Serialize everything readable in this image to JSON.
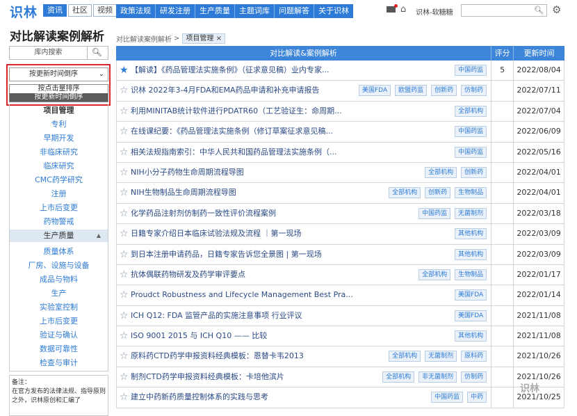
{
  "header": {
    "logo": "识林",
    "subtabs": [
      "资讯",
      "社区",
      "视频"
    ],
    "nav": [
      "政策法规",
      "研发注册",
      "生产质量",
      "主题词库",
      "问题解答",
      "关于识林"
    ],
    "user": "识林-软糖糖"
  },
  "sidebar": {
    "title": "对比解读案例解析",
    "search_placeholder": "库内搜索",
    "sort_value": "按更新时间倒序",
    "sort_options": [
      "按点击量排序",
      "按更新时间倒序"
    ],
    "items_top": [
      "项目管理",
      "专利",
      "早期开发",
      "非临床研究",
      "临床研究",
      "CMC药学研究",
      "注册",
      "上市后变更",
      "药物警戒"
    ],
    "group": "生产质量",
    "items_bottom": [
      "质量体系",
      "厂房、设施与设备",
      "成品与物料",
      "生产",
      "实验室控制",
      "上市后变更",
      "验证与确认",
      "数据可靠性",
      "检查与审计"
    ],
    "note": "备注：\n在官方发布的法律法规、指导原则之外，识林原创和汇编了"
  },
  "breadcrumb": {
    "root": "对比解读案例解析",
    "sep": ">",
    "tag": "项目管理 ×"
  },
  "table": {
    "headers": [
      "对比解读&案例解析",
      "评分",
      "更新时间"
    ],
    "rows": [
      {
        "title": "【解读】《药品管理法实施条例》（征求意见稿）业内专家...",
        "tags": [
          "中国药监"
        ],
        "score": "5",
        "date": "2022/08/04",
        "starred": true
      },
      {
        "title": "识林 2022年3-4月FDA和EMA药品申请和补充申请报告",
        "tags": [
          "美国FDA",
          "欧盟药监",
          "创新药",
          "仿制药"
        ],
        "score": "",
        "date": "2022/07/11",
        "starred": false
      },
      {
        "title": "利用MINITAB统计软件进行PDATR60（工艺验证生：命周期...",
        "tags": [
          "全部机构"
        ],
        "score": "",
        "date": "2022/07/04",
        "starred": false
      },
      {
        "title": "在线课纪要：《药品管理法实施条例（修订草案征求意见稿...",
        "tags": [
          "中国药监"
        ],
        "score": "",
        "date": "2022/06/09",
        "starred": false
      },
      {
        "title": "相关法规指南索引：中华人民共和国药品管理法实施条例（...",
        "tags": [
          "中国药监"
        ],
        "score": "",
        "date": "2022/05/16",
        "starred": false
      },
      {
        "title": "NIH小分子药物生命周期流程导图",
        "tags": [
          "全部机构",
          "创新药"
        ],
        "score": "",
        "date": "2022/04/01",
        "starred": false
      },
      {
        "title": "NIH生物制品生命周期流程导图",
        "tags": [
          "全部机构",
          "创新药",
          "生物制品"
        ],
        "score": "",
        "date": "2022/04/01",
        "starred": false
      },
      {
        "title": "化学药品注射剂仿制药一致性评价流程案例",
        "tags": [
          "中国药监",
          "无菌制剂"
        ],
        "score": "",
        "date": "2022/03/18",
        "starred": false
      },
      {
        "title": "日籍专家介绍日本临床试验法规及流程 ｜第一现场",
        "tags": [
          "其他机构"
        ],
        "score": "",
        "date": "2022/03/09",
        "starred": false
      },
      {
        "title": "到日本注册申请药品，日籍专家告诉您全景图 | 第一现场",
        "tags": [
          "其他机构"
        ],
        "score": "",
        "date": "2022/03/09",
        "starred": false
      },
      {
        "title": "抗体偶联药物研发及药学审评要点",
        "tags": [
          "全部机构",
          "生物制品"
        ],
        "score": "",
        "date": "2022/01/17",
        "starred": false
      },
      {
        "title": "Proudct Robustness and Lifecycle Management Best Pra...",
        "tags": [
          "美国FDA"
        ],
        "score": "",
        "date": "2022/01/14",
        "starred": false
      },
      {
        "title": "ICH Q12: FDA 监管产品的实施注意事项 行业评议",
        "tags": [
          "美国FDA"
        ],
        "score": "",
        "date": "2021/11/08",
        "starred": false
      },
      {
        "title": "ISO 9001 2015 与 ICH Q10 —— 比较",
        "tags": [
          "其他机构"
        ],
        "score": "",
        "date": "2021/11/08",
        "starred": false
      },
      {
        "title": "原料药CTD药学申报资料经典模板：恩替卡韦2013",
        "tags": [
          "全部机构",
          "无菌制剂",
          "原料药"
        ],
        "score": "",
        "date": "2021/10/26",
        "starred": false
      },
      {
        "title": "制剂CTD药学申报资料经典模板：卡培他滨片",
        "tags": [
          "全部机构",
          "非无菌制剂",
          "仿制药"
        ],
        "score": "",
        "date": "2021/10/26",
        "starred": false
      },
      {
        "title": "建立中药新药质量控制体系的实践与思考",
        "tags": [
          "中国药监",
          "中药"
        ],
        "score": "",
        "date": "2021/10/25",
        "starred": false
      }
    ]
  },
  "watermark": "识林"
}
